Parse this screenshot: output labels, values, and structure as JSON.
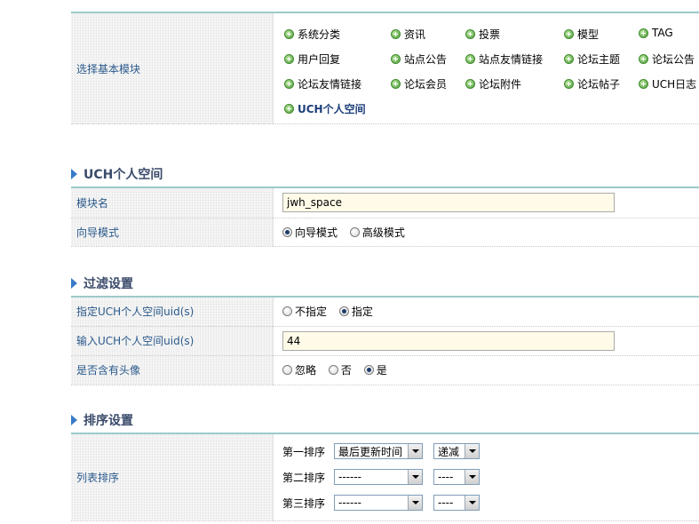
{
  "basic": {
    "label": "选择基本模块",
    "modules": [
      {
        "label": "系统分类"
      },
      {
        "label": "资讯"
      },
      {
        "label": "投票"
      },
      {
        "label": "模型"
      },
      {
        "label": "TAG"
      },
      {
        "label": "用户回复"
      },
      {
        "label": "站点公告"
      },
      {
        "label": "站点友情链接"
      },
      {
        "label": "论坛主题"
      },
      {
        "label": "论坛公告"
      },
      {
        "label": "论坛友情链接"
      },
      {
        "label": "论坛会员"
      },
      {
        "label": "论坛附件"
      },
      {
        "label": "论坛帖子"
      },
      {
        "label": "UCH日志"
      },
      {
        "label": "UCH个人空间"
      }
    ],
    "icon": "add-circle-icon"
  },
  "uch_section": {
    "title": "UCH个人空间",
    "module_name_label": "模块名",
    "module_name_value": "jwh_space",
    "wizard_label": "向导模式",
    "wizard_options": [
      "向导模式",
      "高级模式"
    ]
  },
  "filter_section": {
    "title": "过滤设置",
    "uid_label": "指定UCH个人空间uid(s)",
    "uid_options": [
      "不指定",
      "指定"
    ],
    "input_uid_label": "输入UCH个人空间uid(s)",
    "input_uid_value": "44",
    "avatar_label": "是否含有头像",
    "avatar_options": [
      "忽略",
      "否",
      "是"
    ]
  },
  "sort_section": {
    "title": "排序设置",
    "list_sort_label": "列表排序",
    "rows": [
      {
        "label": "第一排序",
        "field": "最后更新时间",
        "order": "递减"
      },
      {
        "label": "第二排序",
        "field": "------",
        "order": "----"
      },
      {
        "label": "第三排序",
        "field": "------",
        "order": "----"
      }
    ]
  }
}
